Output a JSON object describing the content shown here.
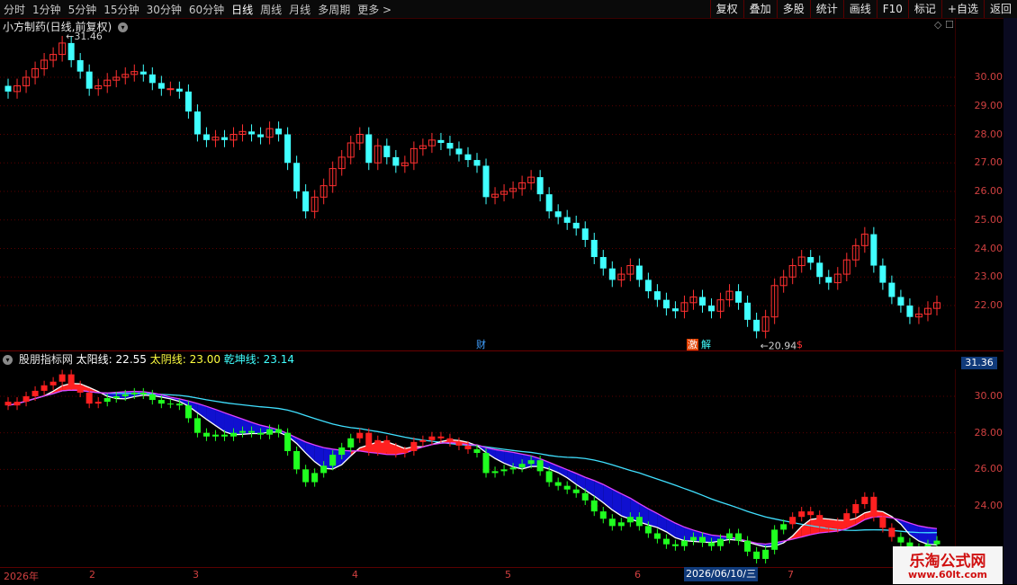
{
  "toolbar": {
    "periods": [
      "分时",
      "1分钟",
      "5分钟",
      "15分钟",
      "30分钟",
      "60分钟",
      "日线",
      "周线",
      "月线",
      "多周期",
      "更多 >"
    ],
    "active_period": "日线",
    "buttons": [
      "复权",
      "叠加",
      "多股",
      "统计",
      "画线",
      "F10",
      "标记",
      "+自选",
      "返回"
    ]
  },
  "chart_header": {
    "title": "小方制药(日线,前复权)"
  },
  "main_chart": {
    "price_axis": [
      "30.00",
      "29.00",
      "28.00",
      "27.00",
      "26.00",
      "25.00",
      "24.00",
      "23.00",
      "22.00"
    ],
    "high_label": "31.46",
    "low_label": "20.94",
    "events": [
      {
        "text": "财",
        "color": "#40a0ff"
      },
      {
        "text": "激",
        "color": "#ffffff",
        "bg": "#e04000"
      },
      {
        "text": "解",
        "color": "#40ffff"
      },
      {
        "text": "$",
        "color": "#ff3030"
      }
    ]
  },
  "indicator": {
    "name": "股朋指标网",
    "taiyang_label": "太阳线:",
    "taiyang_value": "22.55",
    "taiyin_label": "太阴线:",
    "taiyin_value": "23.00",
    "qiankun_label": "乾坤线:",
    "qiankun_value": "23.14",
    "axis": [
      "30.00",
      "28.00",
      "26.00",
      "24.00"
    ],
    "badge": "31.36"
  },
  "date_axis": {
    "labels": [
      "2026年",
      "2",
      "3",
      "4",
      "5",
      "6",
      "7"
    ],
    "cursor_date": "2026/06/10/三"
  },
  "watermark": {
    "title": "乐淘公式网",
    "url": "www.60lt.com"
  },
  "colors": {
    "up": "#ff3030",
    "down": "#40ffff",
    "indicator_up": "#ff2020",
    "indicator_down": "#20ff20",
    "background": "#000000"
  },
  "chart_data": {
    "type": "candlestick",
    "x": [
      "2026-01",
      "2026-02",
      "2026-03",
      "2026-04",
      "2026-05",
      "2026-06",
      "2026-07"
    ],
    "price_range": [
      20.9,
      31.5
    ],
    "closes": [
      29.5,
      29.7,
      30.0,
      30.3,
      30.6,
      30.8,
      31.2,
      30.6,
      30.2,
      29.6,
      29.7,
      29.9,
      30.0,
      30.1,
      30.2,
      30.1,
      29.8,
      29.6,
      29.6,
      29.5,
      28.8,
      28.0,
      27.8,
      27.9,
      27.8,
      28.0,
      28.1,
      28.0,
      27.9,
      28.2,
      28.0,
      27.0,
      26.0,
      25.3,
      25.8,
      26.2,
      26.8,
      27.2,
      27.7,
      28.0,
      27.0,
      27.6,
      27.2,
      26.9,
      27.0,
      27.5,
      27.6,
      27.8,
      27.7,
      27.5,
      27.3,
      27.1,
      26.9,
      25.8,
      25.9,
      26.0,
      26.1,
      26.3,
      26.5,
      25.9,
      25.3,
      25.1,
      24.9,
      24.7,
      24.3,
      23.7,
      23.3,
      22.9,
      23.1,
      23.4,
      22.9,
      22.5,
      22.2,
      21.9,
      21.8,
      22.1,
      22.3,
      22.0,
      21.8,
      22.2,
      22.5,
      22.1,
      21.5,
      21.1,
      21.6,
      22.7,
      23.0,
      23.4,
      23.7,
      23.5,
      23.0,
      22.8,
      23.1,
      23.6,
      24.1,
      24.5,
      23.4,
      22.8,
      22.3,
      22.0,
      21.6,
      21.7,
      21.9,
      22.1
    ]
  }
}
